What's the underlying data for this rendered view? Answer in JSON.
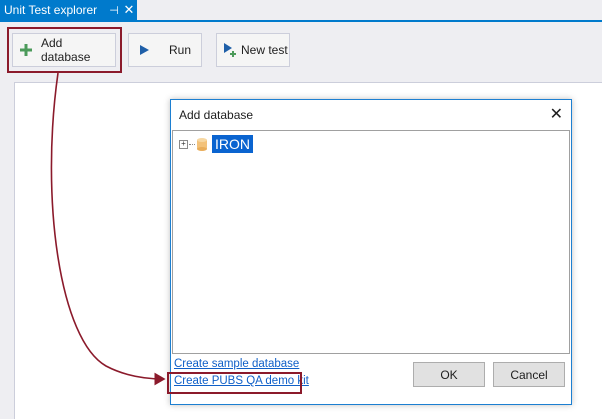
{
  "panel": {
    "title": "Unit Test explorer",
    "pin_glyph": "⊣",
    "close_glyph": "✕"
  },
  "toolbar": {
    "add_database_label": "Add database",
    "run_label": "Run",
    "new_test_label": "New test"
  },
  "dialog": {
    "title": "Add database",
    "close_glyph": "✕",
    "tree": {
      "expander_glyph": "+",
      "server_label": "IRON"
    },
    "link_sample": "Create sample database",
    "link_pubs": "Create PUBS QA demo kit",
    "ok_label": "OK",
    "cancel_label": "Cancel"
  },
  "colors": {
    "accent": "#007acc",
    "highlight": "#8b1a2b",
    "selection": "#0a64d0",
    "link": "#1060c8"
  },
  "icons": {
    "add": "plus-icon",
    "run": "play-icon",
    "new_test": "new-test-icon",
    "database": "database-icon"
  }
}
